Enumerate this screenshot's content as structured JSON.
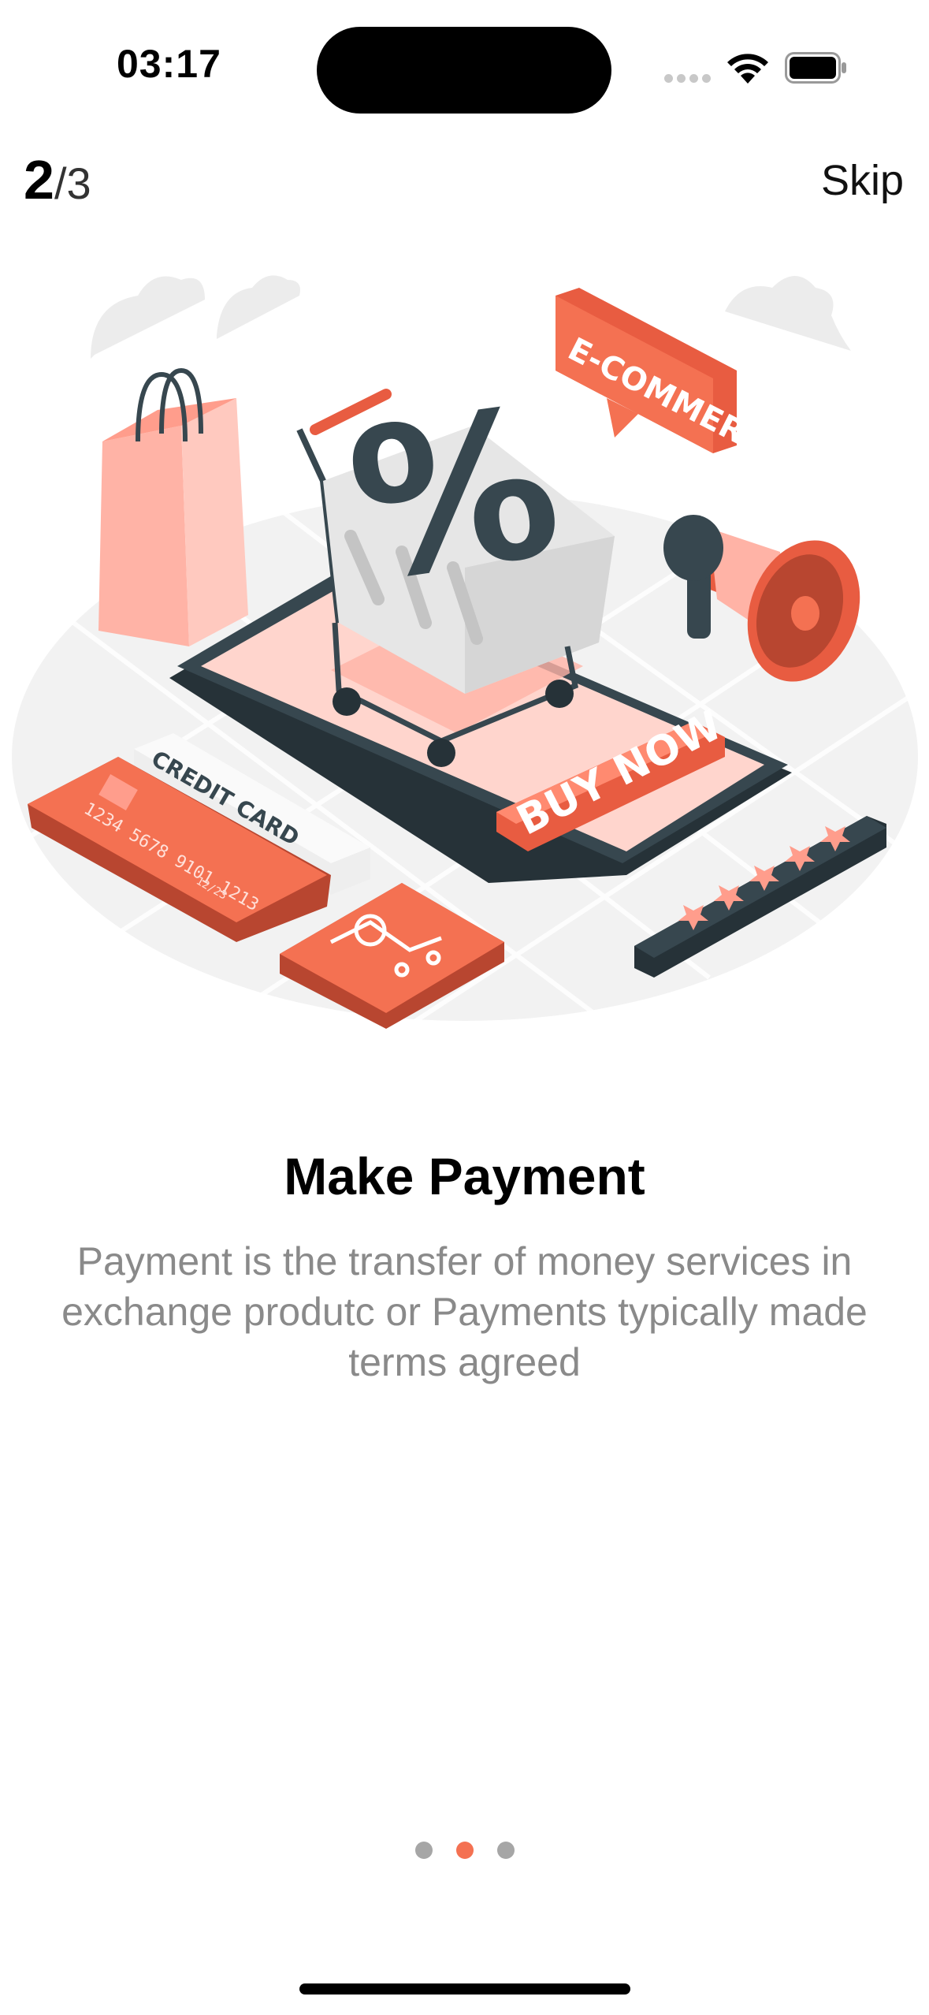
{
  "status_bar": {
    "time": "03:17"
  },
  "header": {
    "page_current": "2",
    "page_total": "/3",
    "skip_label": "Skip"
  },
  "illustration": {
    "ecommerce_sign": "E-COMMERCE",
    "buy_now": "BUY NOW",
    "card_label": "CREDIT CARD",
    "card_number": "1234 5678 9101 1213",
    "card_expiry": "12/23",
    "percent": "%",
    "accent_color": "#f47152"
  },
  "content": {
    "title": "Make Payment",
    "description": "Payment is the transfer of money services in exchange produtc or Payments typically made terms agreed"
  },
  "pagination": {
    "count": 3,
    "active_index": 1
  }
}
